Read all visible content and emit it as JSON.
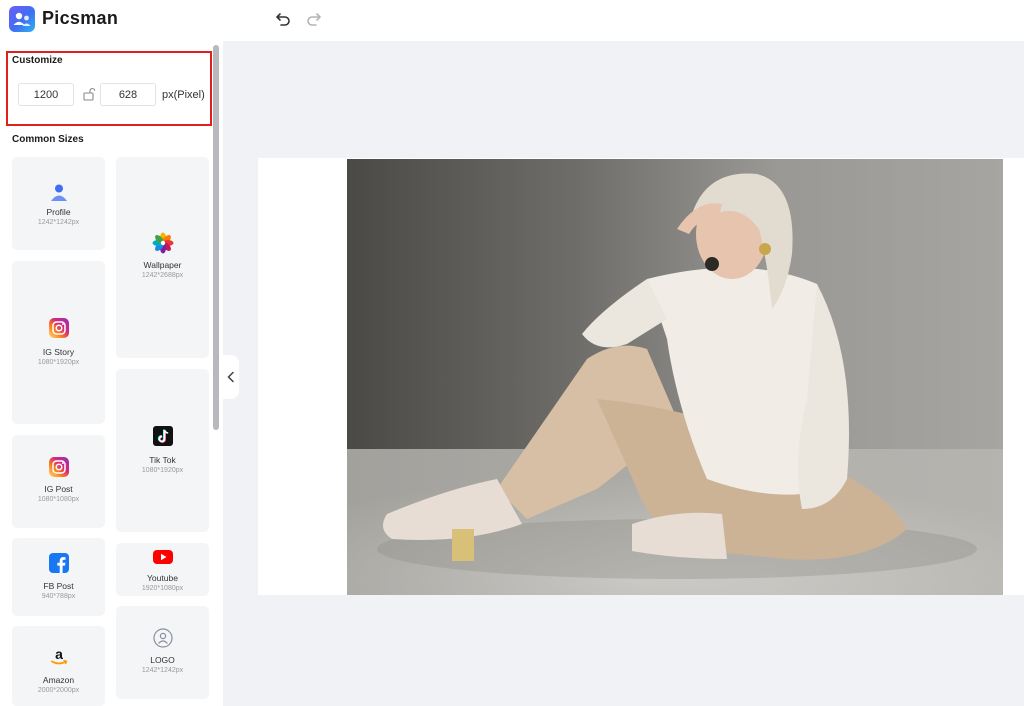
{
  "app": {
    "title": "Picsman"
  },
  "toolbar": {
    "undo_icon": "undo-icon",
    "redo_icon": "redo-icon"
  },
  "customize": {
    "title": "Customize",
    "width_value": "1200",
    "height_value": "628",
    "lock_icon": "lock-open-icon",
    "unit": "px(Pixel)",
    "highlight_color": "#e2201b"
  },
  "common_sizes": {
    "title": "Common Sizes",
    "items": [
      {
        "label": "Profile",
        "size": "1242*1242px",
        "icon": "profile-icon"
      },
      {
        "label": "Wallpaper",
        "size": "1242*2688px",
        "icon": "photos-flower-icon"
      },
      {
        "label": "IG Story",
        "size": "1080*1920px",
        "icon": "instagram-icon"
      },
      {
        "label": "Tik Tok",
        "size": "1080*1920px",
        "icon": "tiktok-icon"
      },
      {
        "label": "IG Post",
        "size": "1080*1080px",
        "icon": "instagram-icon"
      },
      {
        "label": "FB Post",
        "size": "940*788px",
        "icon": "facebook-icon"
      },
      {
        "label": "Youtube",
        "size": "1920*1080px",
        "icon": "youtube-icon"
      },
      {
        "label": "Amazon",
        "size": "2000*2000px",
        "icon": "amazon-icon"
      },
      {
        "label": "LOGO",
        "size": "1242*1242px",
        "icon": "logo-placeholder-icon"
      }
    ]
  },
  "canvas": {
    "image": "photo of a woman in a white knit sweater and beige trousers sitting on the floor"
  },
  "colors": {
    "accent": "#4a63f0",
    "sidebar_card": "#f4f5f7",
    "workspace": "#f1f2f5"
  }
}
